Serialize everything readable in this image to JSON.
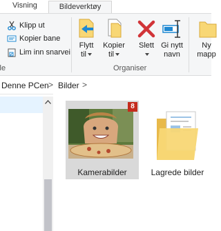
{
  "tabs": {
    "visning": "Visning",
    "bildeverktoy": "Bildeverktøy"
  },
  "ribbon": {
    "clipboard": {
      "group_label": "yle",
      "klipp_ut": "Klipp ut",
      "kopier_bane": "Kopier bane",
      "lim_inn_snarvei": "Lim inn snarvei"
    },
    "organize": {
      "group_label": "Organiser",
      "flytt_line1": "Flytt",
      "flytt_line2": "til",
      "kopier_line1": "Kopier",
      "kopier_line2": "til",
      "slett": "Slett",
      "gi_line1": "Gi nytt",
      "gi_line2": "navn"
    },
    "new": {
      "ny_line1": "Ny",
      "ny_line2": "mapp"
    }
  },
  "address": {
    "crumbs": [
      "Denne PCen",
      "Bilder"
    ],
    "separator": ">"
  },
  "content": {
    "items": [
      {
        "label": "Kamerabilder",
        "badge": "8",
        "selected": true
      },
      {
        "label": "Lagrede bilder"
      }
    ]
  },
  "colors": {
    "accent_blue": "#1e88d2",
    "delete_red": "#d13438",
    "folder_yellow": "#f8d775",
    "badge_red": "#c42b1c",
    "selection": "#d9d9d9"
  },
  "icons": [
    "scissors-icon",
    "copy-path-icon",
    "paste-shortcut-icon",
    "move-to-icon",
    "copy-to-icon",
    "delete-icon",
    "rename-icon",
    "new-folder-icon",
    "folder-icon",
    "scroll-up-icon"
  ]
}
